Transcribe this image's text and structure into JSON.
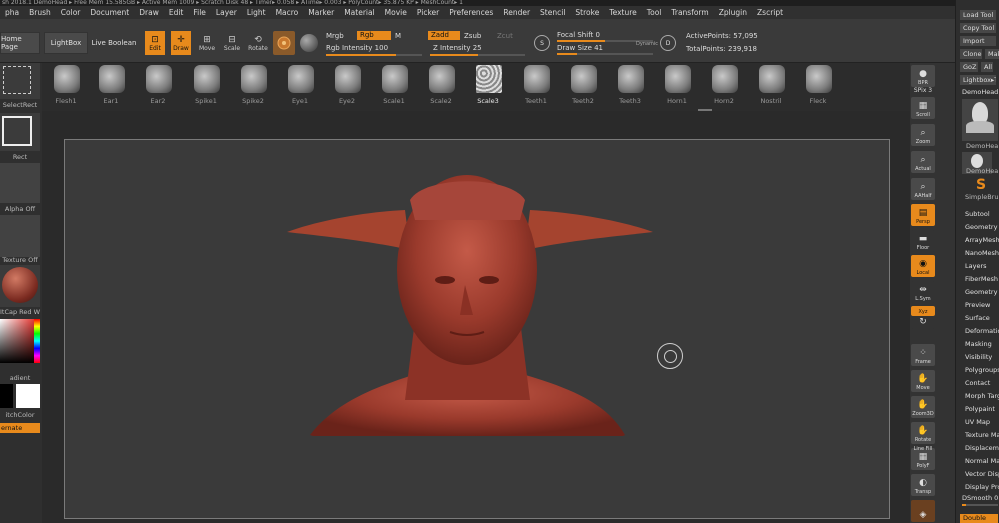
{
  "app": {
    "title_strip": "sh 2018.1 DemoHead  ▸ Free Mem 15.585GB ▸ Active Mem 1009 ▸ Scratch Disk 48 ▸ Timer▸ 0.058 ▸ ATime▸ 0.003 ▸ PolyCount▸ 35.875 KP ▸ MeshCount▸ 1",
    "accent": "#e88a1c"
  },
  "menu": [
    "pha",
    "Brush",
    "Color",
    "Document",
    "Draw",
    "Edit",
    "File",
    "Layer",
    "Light",
    "Macro",
    "Marker",
    "Material",
    "Movie",
    "Picker",
    "Preferences",
    "Render",
    "Stencil",
    "Stroke",
    "Texture",
    "Tool",
    "Transform",
    "Zplugin",
    "Zscript"
  ],
  "toolbar": {
    "home_page": "Home Page",
    "lightbox": "LightBox",
    "live_boolean": "Live Boolean",
    "edit": "Edit",
    "draw": "Draw",
    "move": "Move",
    "scale": "Scale",
    "rotate": "Rotate",
    "mrgb": "Mrgb",
    "rgb": "Rgb",
    "m": "M",
    "rgb_intensity": "Rgb Intensity 100",
    "zadd": "Zadd",
    "zsub": "Zsub",
    "zcut": "Zcut",
    "z_intensity": "Z Intensity 25",
    "focal_shift": "Focal Shift 0",
    "draw_size": "Draw Size 41",
    "dynamic": "Dynamic",
    "active_points": "ActivePoints: 57,095",
    "total_points": "TotalPoints: 239,918"
  },
  "brushes": [
    {
      "label": "Flesh1"
    },
    {
      "label": "Ear1"
    },
    {
      "label": "Ear2"
    },
    {
      "label": "Spike1"
    },
    {
      "label": "Spike2"
    },
    {
      "label": "Eye1"
    },
    {
      "label": "Eye2"
    },
    {
      "label": "Scale1"
    },
    {
      "label": "Scale2"
    },
    {
      "label": "Scale3"
    },
    {
      "label": "Teeth1"
    },
    {
      "label": "Teeth2"
    },
    {
      "label": "Teeth3"
    },
    {
      "label": "Horn1"
    },
    {
      "label": "Horn2"
    },
    {
      "label": "Nostril"
    },
    {
      "label": "Fleck"
    }
  ],
  "left_panel": {
    "select_rect": "SelectRect",
    "rect": "Rect",
    "alpha": "Alpha Off",
    "texture": "Texture Off",
    "material": "ItCap Red W",
    "gradient": "adient",
    "switch_color": "itchColor",
    "alternate": "ernate"
  },
  "right_tools": {
    "bpr": "BPR",
    "spix": "SPix 3",
    "scroll": "Scroll",
    "zoom": "Zoom",
    "actual": "Actual",
    "aahalf": "AAHalf",
    "persp": "Persp",
    "floor": "Floor",
    "local": "Local",
    "lsym": "L.Sym",
    "xyz": "Xyz",
    "frame": "Frame",
    "move": "Move",
    "zoom3d": "Zoom3D",
    "rotate": "Rotate",
    "linefill": "Line Fill",
    "polyf": "PolyF",
    "transp": "Transp"
  },
  "tool_palette": {
    "load_tool": "Load Tool",
    "copy_tool": "Copy Tool",
    "import": "Import",
    "clone": "Clone",
    "make": "Mak",
    "goz": "GoZ",
    "all": "All",
    "lightbox_tools": "Lightbox▸T",
    "demohead_label": "DemoHead:",
    "thumb1": "DemoHea",
    "thumb2": "DemoHea",
    "thumb3": "SimpleBru",
    "sections": [
      "Subtool",
      "Geometry",
      "ArrayMesh",
      "NanoMesh",
      "Layers",
      "FiberMesh",
      "Geometry H",
      "Preview",
      "Surface",
      "Deformatio",
      "Masking",
      "Visibility",
      "Polygroups",
      "Contact",
      "Morph Targ",
      "Polypaint",
      "UV Map",
      "Texture Ma",
      "Displacem",
      "Normal Ma",
      "Vector Disp",
      "Display Pro"
    ],
    "dsmooth": "DSmooth 0",
    "double": "Double"
  }
}
